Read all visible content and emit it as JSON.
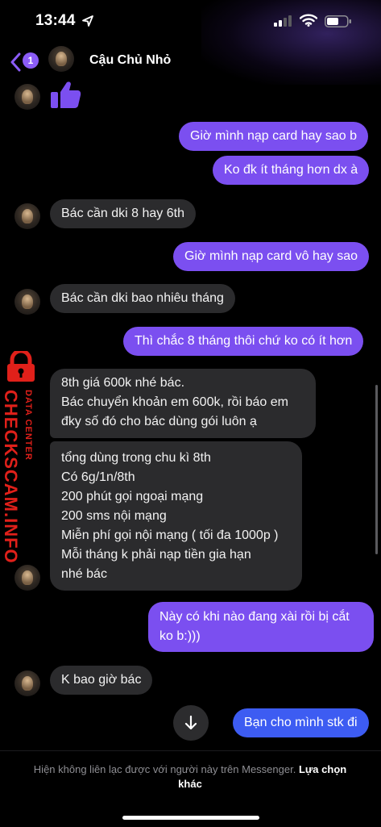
{
  "status_bar": {
    "time": "13:44"
  },
  "header": {
    "back_badge": "1",
    "contact_name": "Cậu Chủ Nhỏ"
  },
  "messages": [
    {
      "from": "them",
      "kind": "thumbs_up"
    },
    {
      "from": "me",
      "text": "Giờ mình nạp card hay sao b"
    },
    {
      "from": "me",
      "text": "Ko đk ít tháng hơn dx à"
    },
    {
      "from": "them",
      "text": "Bác cần dki 8 hay 6th"
    },
    {
      "from": "me",
      "text": "Giờ mình nạp card vô hay sao"
    },
    {
      "from": "them",
      "text": "Bác cần dki bao nhiêu tháng"
    },
    {
      "from": "me",
      "text": "Thì chắc 8 tháng thôi chứ ko có ít hơn"
    },
    {
      "from": "them",
      "lines": [
        "8th giá 600k nhé bác.",
        "Bác chuyển khoản em 600k, rồi báo em",
        "đky số đó cho bác dùng gói luôn ạ"
      ]
    },
    {
      "from": "them",
      "lines": [
        "tổng dùng trong chu kì 8th",
        "Có 6g/1n/8th",
        "200 phút gọi ngoại mạng",
        "200 sms nội mạng",
        "Miễn phí gọi nội mạng ( tối đa 1000p )",
        "Mỗi tháng k phải nạp tiền gia hạn",
        "nhé bác"
      ]
    },
    {
      "from": "me",
      "lines": [
        "Này có khi nào đang xài rồi bị cắt",
        "ko b:)))"
      ]
    },
    {
      "from": "them",
      "text": "K bao giờ bác"
    },
    {
      "from": "me",
      "text": "Bạn cho mình stk đi"
    }
  ],
  "watermark": {
    "main": "CHECKSCAM.INFO",
    "sub": "DATA CENTER"
  },
  "footer": {
    "notice": "Hiện không liên lạc được với người này trên Messenger.",
    "link": "Lựa chọn khác"
  },
  "colors": {
    "outgoing": "#7b4ff0",
    "outgoing_latest": "#3d5cf2",
    "incoming": "#2b2b2d",
    "watermark": "#e0201a"
  }
}
